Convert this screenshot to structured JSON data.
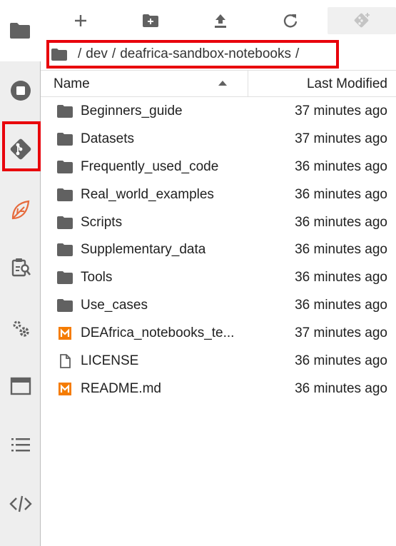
{
  "sidebar": {
    "items": [
      {
        "name": "file-browser",
        "icon": "folder-icon"
      },
      {
        "name": "running-terminals",
        "icon": "stop-circle-icon"
      },
      {
        "name": "git",
        "icon": "git-icon"
      },
      {
        "name": "extension",
        "icon": "leaf-icon"
      },
      {
        "name": "property-inspector",
        "icon": "clipboard-search-icon"
      },
      {
        "name": "settings",
        "icon": "gears-icon"
      },
      {
        "name": "tabs",
        "icon": "window-icon"
      },
      {
        "name": "table-of-contents",
        "icon": "list-icon"
      },
      {
        "name": "code",
        "icon": "code-icon"
      }
    ]
  },
  "toolbar": {
    "buttons": [
      "new-launcher",
      "new-folder",
      "upload",
      "refresh",
      "git-clone"
    ]
  },
  "breadcrumb": {
    "separator1": "/",
    "dir1": "dev",
    "separator2": "/",
    "dir2": "deafrica-sandbox-notebooks",
    "separator3": "/"
  },
  "header": {
    "name": "Name",
    "last_modified": "Last Modified"
  },
  "files": [
    {
      "name": "Beginners_guide",
      "type": "folder",
      "modified": "37 minutes ago"
    },
    {
      "name": "Datasets",
      "type": "folder",
      "modified": "37 minutes ago"
    },
    {
      "name": "Frequently_used_code",
      "type": "folder",
      "modified": "36 minutes ago"
    },
    {
      "name": "Real_world_examples",
      "type": "folder",
      "modified": "36 minutes ago"
    },
    {
      "name": "Scripts",
      "type": "folder",
      "modified": "36 minutes ago"
    },
    {
      "name": "Supplementary_data",
      "type": "folder",
      "modified": "36 minutes ago"
    },
    {
      "name": "Tools",
      "type": "folder",
      "modified": "36 minutes ago"
    },
    {
      "name": "Use_cases",
      "type": "folder",
      "modified": "36 minutes ago"
    },
    {
      "name": "DEAfrica_notebooks_te...",
      "type": "markdown",
      "modified": "37 minutes ago"
    },
    {
      "name": "LICENSE",
      "type": "file",
      "modified": "36 minutes ago"
    },
    {
      "name": "README.md",
      "type": "markdown",
      "modified": "36 minutes ago"
    }
  ],
  "colors": {
    "highlight": "#e8000b",
    "icon": "#616161",
    "markdown": "#f57c00",
    "leaf": "#e66a3c"
  }
}
